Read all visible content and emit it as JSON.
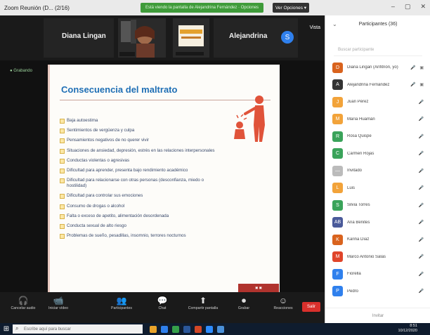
{
  "window": {
    "title": "Zoom Reunión (D... (2/16)",
    "share_banner": "Está viendo la pantalla de Alejandrina Fernández · Opciones",
    "view_options": "Ver Opciones ▾"
  },
  "video_strip": {
    "tile1_name": "Diana Lingan",
    "tile3_name": "Alejandrina",
    "view_label": "Vista"
  },
  "share_label": "● Grabando",
  "slide": {
    "title": "Consecuencia del maltrato",
    "bullets": [
      "Baja autoestima",
      "Sentimientos de vergüenza y culpa",
      "Pensamientos negativos de no querer vivir",
      "Situaciones de ansiedad, depresión, estrés en las relaciones interpersonales",
      "Conductas violentas o agresivas",
      "Dificultad para aprender, presenta bajo rendimiento académico",
      "Dificultad para relacionarse con otras personas (desconfianza, miedo o hostilidad)",
      "Dificultad para controlar sus emociones",
      "Consumo de drogas o alcohol",
      "Falta o exceso de apetito, alimentación desordenada",
      "Conducta sexual de alto riesgo",
      "Problemas de sueño, pesadillas, insomnio, terrores nocturnos"
    ]
  },
  "panel": {
    "title": "Participantes (36)",
    "search_placeholder": "Buscar participante",
    "participants": [
      {
        "initial": "D",
        "name": "Diana Lingan (Anfitrión, yo)",
        "color": "#d9631e",
        "icons": "🎤 ▣"
      },
      {
        "initial": "A",
        "name": "Alejandrina Fernández",
        "color": "#333333",
        "icons": "🎤 ▣"
      },
      {
        "initial": "J",
        "name": "Juan Pérez",
        "color": "#f2a33a",
        "icons": "🎤"
      },
      {
        "initial": "M",
        "name": "María Huamán",
        "color": "#f2a33a",
        "icons": "🎤"
      },
      {
        "initial": "R",
        "name": "Rosa Quispe",
        "color": "#3aa35a",
        "icons": "🎤"
      },
      {
        "initial": "C",
        "name": "Carmen Rojas",
        "color": "#3aa35a",
        "icons": "🎤"
      },
      {
        "initial": "—",
        "name": "Invitado",
        "color": "#bbbbbb",
        "icons": "🎤"
      },
      {
        "initial": "L",
        "name": "Luis",
        "color": "#f2a33a",
        "icons": "🎤"
      },
      {
        "initial": "S",
        "name": "Silvia Torres",
        "color": "#3aa35a",
        "icons": "🎤"
      },
      {
        "initial": "AB",
        "name": "Ana Benites",
        "color": "#4a5a9a",
        "icons": "🎤"
      },
      {
        "initial": "K",
        "name": "Karina Díaz",
        "color": "#d9631e",
        "icons": "🎤"
      },
      {
        "initial": "M",
        "name": "Marco Antonio Salas",
        "color": "#e0452a",
        "icons": "🎤"
      },
      {
        "initial": "F",
        "name": "Fiorella",
        "color": "#2f80ed",
        "icons": "🎤"
      },
      {
        "initial": "P",
        "name": "Pedro",
        "color": "#2f80ed",
        "icons": "🎤"
      }
    ],
    "footer": "Invitar"
  },
  "toolbar": {
    "items": [
      {
        "icon": "🎧",
        "label": "Cancelar audio"
      },
      {
        "icon": "📹",
        "label": "Iniciar vídeo"
      },
      {
        "icon": "👥",
        "label": "Participantes"
      },
      {
        "icon": "💬",
        "label": "Chat"
      },
      {
        "icon": "⬆",
        "label": "Compartir pantalla"
      },
      {
        "icon": "⏺",
        "label": "Grabar"
      },
      {
        "icon": "☺",
        "label": "Reacciones"
      }
    ],
    "end_label": "Salir"
  },
  "taskbar": {
    "search_placeholder": "Escribe aquí para buscar",
    "time": "8:51",
    "date": "10/12/2020"
  },
  "colors": {
    "accent_blue": "#1f6fb5",
    "end_red": "#d9302c",
    "share_green": "#3f9b3a"
  }
}
